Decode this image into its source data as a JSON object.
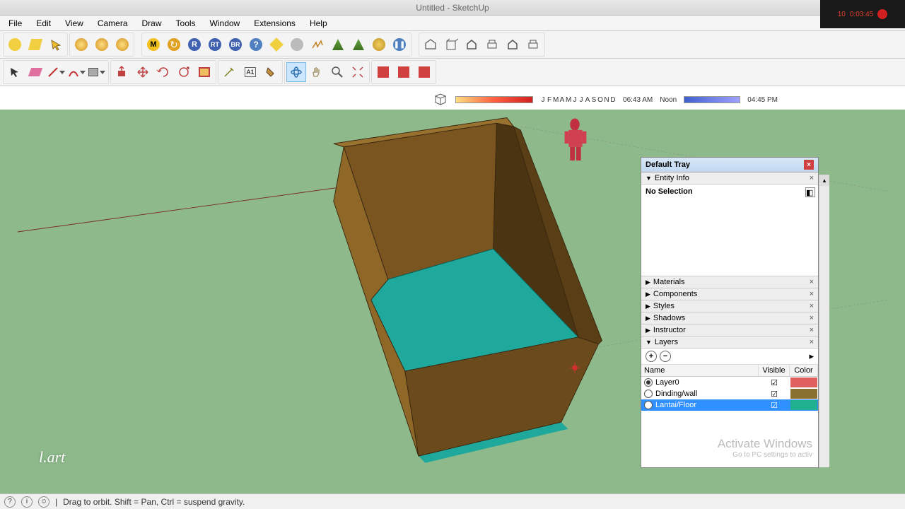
{
  "window": {
    "title": "Untitled - SketchUp"
  },
  "recorder": {
    "fps": "10",
    "time": "0:03:45"
  },
  "menus": [
    "File",
    "Edit",
    "View",
    "Camera",
    "Draw",
    "Tools",
    "Window",
    "Extensions",
    "Help"
  ],
  "time": {
    "months": [
      "J",
      "F",
      "M",
      "A",
      "M",
      "J",
      "J",
      "A",
      "S",
      "O",
      "N",
      "D"
    ],
    "t1": "06:43 AM",
    "t2": "Noon",
    "t3": "04:45 PM"
  },
  "tray": {
    "title": "Default Tray",
    "entity": {
      "title": "Entity Info",
      "status": "No Selection"
    },
    "panels": [
      "Materials",
      "Components",
      "Styles",
      "Shadows",
      "Instructor",
      "Layers"
    ],
    "layers": {
      "cols": {
        "name": "Name",
        "visible": "Visible",
        "color": "Color"
      },
      "rows": [
        {
          "name": "Layer0",
          "visible": true,
          "active": true,
          "color": "#e06060"
        },
        {
          "name": "Dinding/wall",
          "visible": true,
          "active": false,
          "color": "#8a7030"
        },
        {
          "name": "Lantai/Floor",
          "visible": true,
          "active": false,
          "color": "#20b090",
          "selected": true
        }
      ]
    }
  },
  "activate": {
    "big": "Activate Windows",
    "small": "Go to PC settings to activ"
  },
  "status": {
    "hint": "Drag to orbit. Shift = Pan, Ctrl = suspend gravity."
  },
  "watermark": "l.art"
}
